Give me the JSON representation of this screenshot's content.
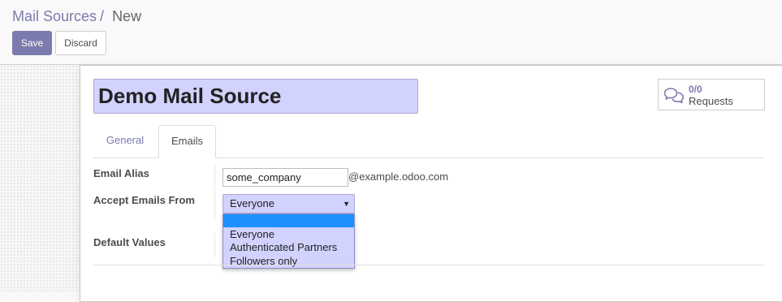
{
  "breadcrumb": {
    "parent": "Mail Sources",
    "separator": "/",
    "current": "New"
  },
  "buttons": {
    "save": "Save",
    "discard": "Discard"
  },
  "record": {
    "name": "Demo Mail Source"
  },
  "stat_button": {
    "value": "0/0",
    "label": "Requests",
    "icon": "comments-icon"
  },
  "tabs": [
    {
      "label": "General",
      "active": false
    },
    {
      "label": "Emails",
      "active": true
    }
  ],
  "fields": {
    "email_alias": {
      "label": "Email Alias",
      "value": "some_company",
      "domain": "@example.odoo.com"
    },
    "accept_from": {
      "label": "Accept Emails From",
      "value": "Everyone",
      "options": [
        "",
        "Everyone",
        "Authenticated Partners",
        "Followers only"
      ]
    },
    "default_values": {
      "label": "Default Values"
    }
  },
  "colors": {
    "accent": "#7c7bad",
    "required_bg": "#d2d2ff",
    "highlight": "#1e90ff"
  }
}
